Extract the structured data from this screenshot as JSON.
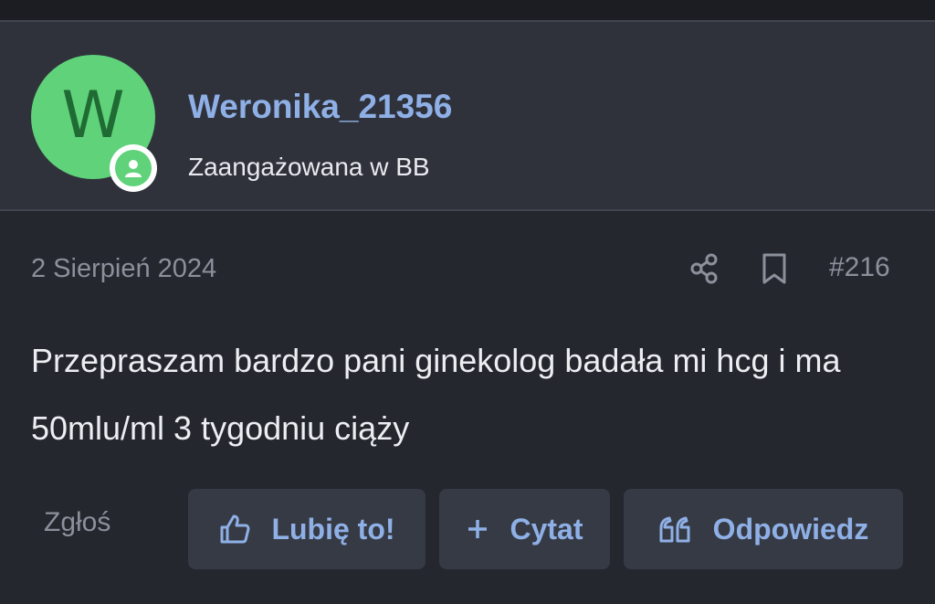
{
  "author": {
    "avatar_letter": "W",
    "username": "Weronika_21356",
    "title": "Zaangażowana w BB",
    "avatar_color": "#5fd27a"
  },
  "post": {
    "date": "2 Sierpień 2024",
    "number": "#216",
    "body": "Przepraszam bardzo pani ginekolog badała mi hcg i ma 50mlu/ml 3 tygodniu ciąży"
  },
  "actions": {
    "report_label": "Zgłoś",
    "like_label": "Lubię to!",
    "quote_label": "Cytat",
    "reply_label": "Odpowiedz"
  },
  "colors": {
    "accent": "#8fb0e6",
    "background": "#25272f",
    "panel": "#2f323b",
    "button": "#363a44"
  }
}
